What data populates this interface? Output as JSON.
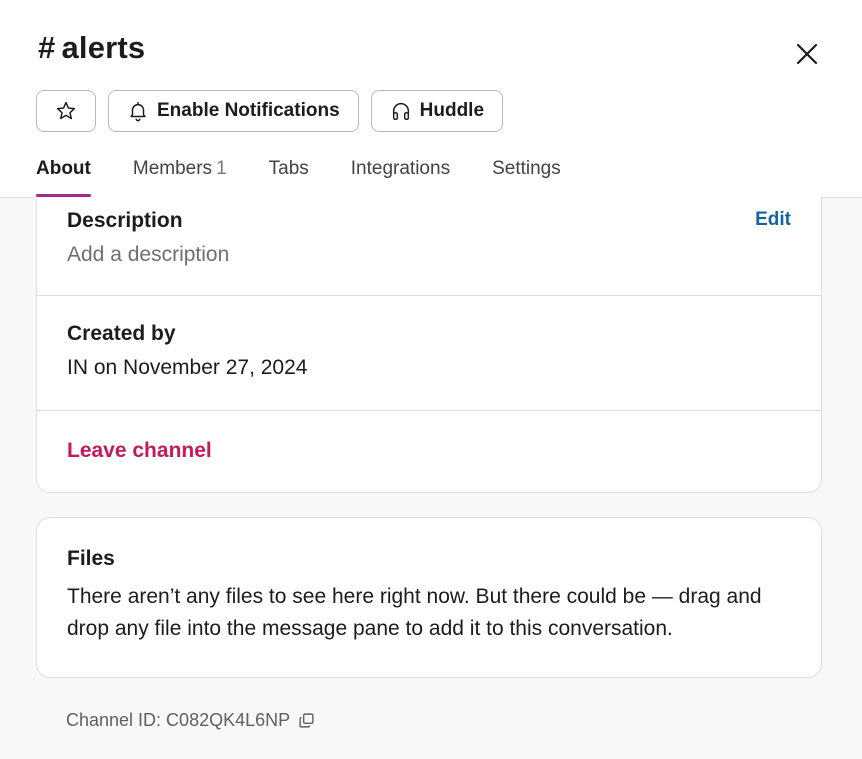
{
  "header": {
    "hash": "#",
    "channel_name": "alerts",
    "buttons": {
      "enable_notifications": "Enable Notifications",
      "huddle": "Huddle"
    },
    "tabs": [
      {
        "label": "About"
      },
      {
        "label": "Members",
        "count": "1"
      },
      {
        "label": "Tabs"
      },
      {
        "label": "Integrations"
      },
      {
        "label": "Settings"
      }
    ]
  },
  "about": {
    "description": {
      "title": "Description",
      "value": "Add a description",
      "edit_label": "Edit"
    },
    "created_by": {
      "title": "Created by",
      "value": "IN on November 27, 2024"
    },
    "leave_label": "Leave channel"
  },
  "files": {
    "title": "Files",
    "text": "There aren’t any files to see here right now. But there could be — drag and drop any file into the message pane to add it to this conversation."
  },
  "footer": {
    "channel_id_label": "Channel ID: C082QK4L6NP"
  },
  "icons": {
    "star": "star-icon",
    "bell": "bell-icon",
    "headphones": "headphones-icon",
    "close": "close-icon",
    "copy": "copy-icon"
  },
  "colors": {
    "accent_tab": "#9e2a8e",
    "link": "#1264a3",
    "danger": "#c3195d"
  }
}
